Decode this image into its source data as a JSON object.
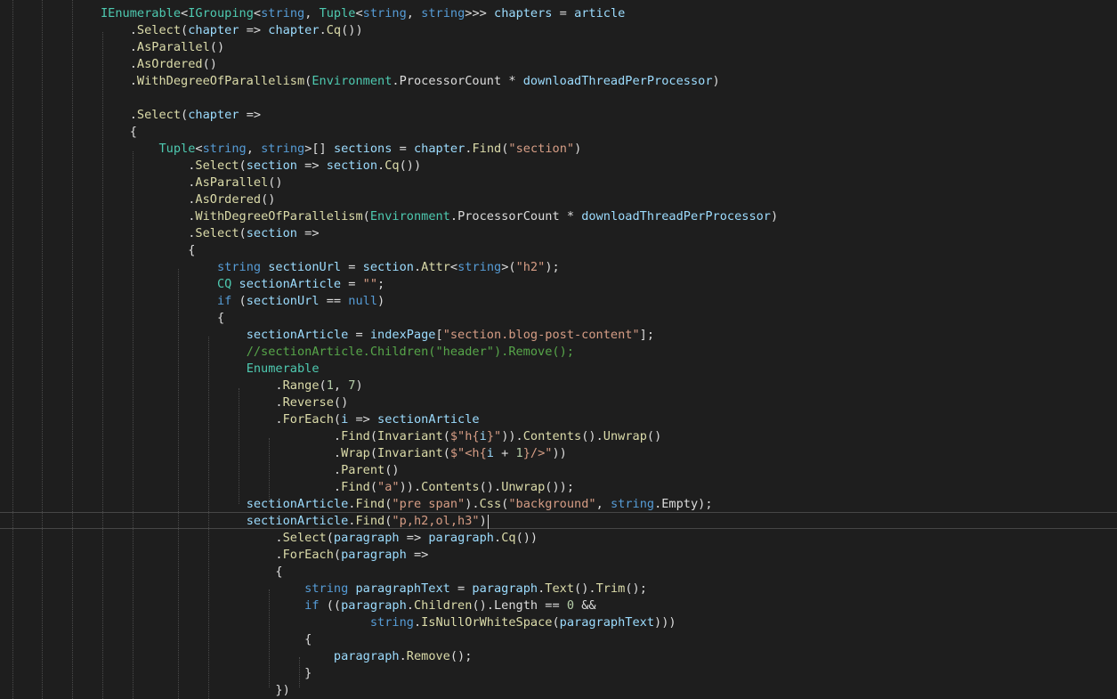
{
  "editor": {
    "colors": {
      "background": "#1e1e1e",
      "keyword": "#569cd6",
      "type": "#4ec9b0",
      "string": "#d69d85",
      "number": "#b5cea8",
      "comment": "#57a64a",
      "method": "#dcdcaa",
      "variable": "#9cdcfe",
      "plain": "#dcdcdc"
    },
    "current_line": 30,
    "lines": [
      [
        [
          "type",
          "IEnumerable"
        ],
        [
          "punct",
          "<"
        ],
        [
          "type",
          "IGrouping"
        ],
        [
          "punct",
          "<"
        ],
        [
          "keyword",
          "string"
        ],
        [
          "punct",
          ", "
        ],
        [
          "type",
          "Tuple"
        ],
        [
          "punct",
          "<"
        ],
        [
          "keyword",
          "string"
        ],
        [
          "punct",
          ", "
        ],
        [
          "keyword",
          "string"
        ],
        [
          "punct",
          ">>> "
        ],
        [
          "variable",
          "chapters"
        ],
        [
          "punct",
          " = "
        ],
        [
          "variable",
          "article"
        ]
      ],
      [
        [
          "punct",
          "    ."
        ],
        [
          "method",
          "Select"
        ],
        [
          "punct",
          "("
        ],
        [
          "variable",
          "chapter"
        ],
        [
          "punct",
          " => "
        ],
        [
          "variable",
          "chapter"
        ],
        [
          "punct",
          "."
        ],
        [
          "method",
          "Cq"
        ],
        [
          "punct",
          "())"
        ]
      ],
      [
        [
          "punct",
          "    ."
        ],
        [
          "method",
          "AsParallel"
        ],
        [
          "punct",
          "()"
        ]
      ],
      [
        [
          "punct",
          "    ."
        ],
        [
          "method",
          "AsOrdered"
        ],
        [
          "punct",
          "()"
        ]
      ],
      [
        [
          "punct",
          "    ."
        ],
        [
          "method",
          "WithDegreeOfParallelism"
        ],
        [
          "punct",
          "("
        ],
        [
          "type",
          "Environment"
        ],
        [
          "punct",
          "."
        ],
        [
          "plain",
          "ProcessorCount"
        ],
        [
          "punct",
          " * "
        ],
        [
          "variable",
          "downloadThreadPerProcessor"
        ],
        [
          "punct",
          ")"
        ]
      ],
      [],
      [
        [
          "punct",
          "    ."
        ],
        [
          "method",
          "Select"
        ],
        [
          "punct",
          "("
        ],
        [
          "variable",
          "chapter"
        ],
        [
          "punct",
          " =>"
        ]
      ],
      [
        [
          "punct",
          "    {"
        ]
      ],
      [
        [
          "punct",
          "        "
        ],
        [
          "type",
          "Tuple"
        ],
        [
          "punct",
          "<"
        ],
        [
          "keyword",
          "string"
        ],
        [
          "punct",
          ", "
        ],
        [
          "keyword",
          "string"
        ],
        [
          "punct",
          ">[] "
        ],
        [
          "variable",
          "sections"
        ],
        [
          "punct",
          " = "
        ],
        [
          "variable",
          "chapter"
        ],
        [
          "punct",
          "."
        ],
        [
          "method",
          "Find"
        ],
        [
          "punct",
          "("
        ],
        [
          "string",
          "\"section\""
        ],
        [
          "punct",
          ")"
        ]
      ],
      [
        [
          "punct",
          "            ."
        ],
        [
          "method",
          "Select"
        ],
        [
          "punct",
          "("
        ],
        [
          "variable",
          "section"
        ],
        [
          "punct",
          " => "
        ],
        [
          "variable",
          "section"
        ],
        [
          "punct",
          "."
        ],
        [
          "method",
          "Cq"
        ],
        [
          "punct",
          "())"
        ]
      ],
      [
        [
          "punct",
          "            ."
        ],
        [
          "method",
          "AsParallel"
        ],
        [
          "punct",
          "()"
        ]
      ],
      [
        [
          "punct",
          "            ."
        ],
        [
          "method",
          "AsOrdered"
        ],
        [
          "punct",
          "()"
        ]
      ],
      [
        [
          "punct",
          "            ."
        ],
        [
          "method",
          "WithDegreeOfParallelism"
        ],
        [
          "punct",
          "("
        ],
        [
          "type",
          "Environment"
        ],
        [
          "punct",
          "."
        ],
        [
          "plain",
          "ProcessorCount"
        ],
        [
          "punct",
          " * "
        ],
        [
          "variable",
          "downloadThreadPerProcessor"
        ],
        [
          "punct",
          ")"
        ]
      ],
      [
        [
          "punct",
          "            ."
        ],
        [
          "method",
          "Select"
        ],
        [
          "punct",
          "("
        ],
        [
          "variable",
          "section"
        ],
        [
          "punct",
          " =>"
        ]
      ],
      [
        [
          "punct",
          "            {"
        ]
      ],
      [
        [
          "punct",
          "                "
        ],
        [
          "keyword",
          "string"
        ],
        [
          "punct",
          " "
        ],
        [
          "variable",
          "sectionUrl"
        ],
        [
          "punct",
          " = "
        ],
        [
          "variable",
          "section"
        ],
        [
          "punct",
          "."
        ],
        [
          "method",
          "Attr"
        ],
        [
          "punct",
          "<"
        ],
        [
          "keyword",
          "string"
        ],
        [
          "punct",
          ">("
        ],
        [
          "string",
          "\"h2\""
        ],
        [
          "punct",
          ");"
        ]
      ],
      [
        [
          "punct",
          "                "
        ],
        [
          "type",
          "CQ"
        ],
        [
          "punct",
          " "
        ],
        [
          "variable",
          "sectionArticle"
        ],
        [
          "punct",
          " = "
        ],
        [
          "string",
          "\"\""
        ],
        [
          "punct",
          ";"
        ]
      ],
      [
        [
          "punct",
          "                "
        ],
        [
          "keyword",
          "if"
        ],
        [
          "punct",
          " ("
        ],
        [
          "variable",
          "sectionUrl"
        ],
        [
          "punct",
          " == "
        ],
        [
          "keyword",
          "null"
        ],
        [
          "punct",
          ")"
        ]
      ],
      [
        [
          "punct",
          "                {"
        ]
      ],
      [
        [
          "punct",
          "                    "
        ],
        [
          "variable",
          "sectionArticle"
        ],
        [
          "punct",
          " = "
        ],
        [
          "variable",
          "indexPage"
        ],
        [
          "punct",
          "["
        ],
        [
          "string",
          "\"section.blog-post-content\""
        ],
        [
          "punct",
          "];"
        ]
      ],
      [
        [
          "punct",
          "                    "
        ],
        [
          "comment",
          "//sectionArticle.Children(\"header\").Remove();"
        ]
      ],
      [
        [
          "punct",
          "                    "
        ],
        [
          "type",
          "Enumerable"
        ]
      ],
      [
        [
          "punct",
          "                        ."
        ],
        [
          "method",
          "Range"
        ],
        [
          "punct",
          "("
        ],
        [
          "number",
          "1"
        ],
        [
          "punct",
          ", "
        ],
        [
          "number",
          "7"
        ],
        [
          "punct",
          ")"
        ]
      ],
      [
        [
          "punct",
          "                        ."
        ],
        [
          "method",
          "Reverse"
        ],
        [
          "punct",
          "()"
        ]
      ],
      [
        [
          "punct",
          "                        ."
        ],
        [
          "method",
          "ForEach"
        ],
        [
          "punct",
          "("
        ],
        [
          "variable",
          "i"
        ],
        [
          "punct",
          " => "
        ],
        [
          "variable",
          "sectionArticle"
        ]
      ],
      [
        [
          "punct",
          "                                ."
        ],
        [
          "method",
          "Find"
        ],
        [
          "punct",
          "("
        ],
        [
          "method",
          "Invariant"
        ],
        [
          "punct",
          "("
        ],
        [
          "string",
          "$\"h{"
        ],
        [
          "variable",
          "i"
        ],
        [
          "string",
          "}\""
        ],
        [
          "punct",
          "))."
        ],
        [
          "method",
          "Contents"
        ],
        [
          "punct",
          "()."
        ],
        [
          "method",
          "Unwrap"
        ],
        [
          "punct",
          "()"
        ]
      ],
      [
        [
          "punct",
          "                                ."
        ],
        [
          "method",
          "Wrap"
        ],
        [
          "punct",
          "("
        ],
        [
          "method",
          "Invariant"
        ],
        [
          "punct",
          "("
        ],
        [
          "string",
          "$\"<h{"
        ],
        [
          "variable",
          "i"
        ],
        [
          "punct",
          " + "
        ],
        [
          "number",
          "1"
        ],
        [
          "string",
          "}/>\""
        ],
        [
          "punct",
          "))"
        ]
      ],
      [
        [
          "punct",
          "                                ."
        ],
        [
          "method",
          "Parent"
        ],
        [
          "punct",
          "()"
        ]
      ],
      [
        [
          "punct",
          "                                ."
        ],
        [
          "method",
          "Find"
        ],
        [
          "punct",
          "("
        ],
        [
          "string",
          "\"a\""
        ],
        [
          "punct",
          "))."
        ],
        [
          "method",
          "Contents"
        ],
        [
          "punct",
          "()."
        ],
        [
          "method",
          "Unwrap"
        ],
        [
          "punct",
          "());"
        ]
      ],
      [
        [
          "punct",
          "                    "
        ],
        [
          "variable",
          "sectionArticle"
        ],
        [
          "punct",
          "."
        ],
        [
          "method",
          "Find"
        ],
        [
          "punct",
          "("
        ],
        [
          "string",
          "\"pre span\""
        ],
        [
          "punct",
          ")."
        ],
        [
          "method",
          "Css"
        ],
        [
          "punct",
          "("
        ],
        [
          "string",
          "\"background\""
        ],
        [
          "punct",
          ", "
        ],
        [
          "keyword",
          "string"
        ],
        [
          "punct",
          "."
        ],
        [
          "plain",
          "Empty"
        ],
        [
          "punct",
          ");"
        ]
      ],
      [
        [
          "punct",
          "                    "
        ],
        [
          "variable",
          "sectionArticle"
        ],
        [
          "punct",
          "."
        ],
        [
          "method",
          "Find"
        ],
        [
          "punct",
          "("
        ],
        [
          "string",
          "\"p,h2,ol,h3\""
        ],
        [
          "punct",
          ")"
        ]
      ],
      [
        [
          "punct",
          "                        ."
        ],
        [
          "method",
          "Select"
        ],
        [
          "punct",
          "("
        ],
        [
          "variable",
          "paragraph"
        ],
        [
          "punct",
          " => "
        ],
        [
          "variable",
          "paragraph"
        ],
        [
          "punct",
          "."
        ],
        [
          "method",
          "Cq"
        ],
        [
          "punct",
          "())"
        ]
      ],
      [
        [
          "punct",
          "                        ."
        ],
        [
          "method",
          "ForEach"
        ],
        [
          "punct",
          "("
        ],
        [
          "variable",
          "paragraph"
        ],
        [
          "punct",
          " =>"
        ]
      ],
      [
        [
          "punct",
          "                        {"
        ]
      ],
      [
        [
          "punct",
          "                            "
        ],
        [
          "keyword",
          "string"
        ],
        [
          "punct",
          " "
        ],
        [
          "variable",
          "paragraphText"
        ],
        [
          "punct",
          " = "
        ],
        [
          "variable",
          "paragraph"
        ],
        [
          "punct",
          "."
        ],
        [
          "method",
          "Text"
        ],
        [
          "punct",
          "()."
        ],
        [
          "method",
          "Trim"
        ],
        [
          "punct",
          "();"
        ]
      ],
      [
        [
          "punct",
          "                            "
        ],
        [
          "keyword",
          "if"
        ],
        [
          "punct",
          " (("
        ],
        [
          "variable",
          "paragraph"
        ],
        [
          "punct",
          "."
        ],
        [
          "method",
          "Children"
        ],
        [
          "punct",
          "()."
        ],
        [
          "plain",
          "Length"
        ],
        [
          "punct",
          " == "
        ],
        [
          "number",
          "0"
        ],
        [
          "punct",
          " &&"
        ]
      ],
      [
        [
          "punct",
          "                                     "
        ],
        [
          "keyword",
          "string"
        ],
        [
          "punct",
          "."
        ],
        [
          "method",
          "IsNullOrWhiteSpace"
        ],
        [
          "punct",
          "("
        ],
        [
          "variable",
          "paragraphText"
        ],
        [
          "punct",
          "))) "
        ]
      ],
      [
        [
          "punct",
          "                            {"
        ]
      ],
      [
        [
          "punct",
          "                                "
        ],
        [
          "variable",
          "paragraph"
        ],
        [
          "punct",
          "."
        ],
        [
          "method",
          "Remove"
        ],
        [
          "punct",
          "();"
        ]
      ],
      [
        [
          "punct",
          "                            }"
        ]
      ],
      [
        [
          "punct",
          "                        })"
        ]
      ]
    ]
  }
}
